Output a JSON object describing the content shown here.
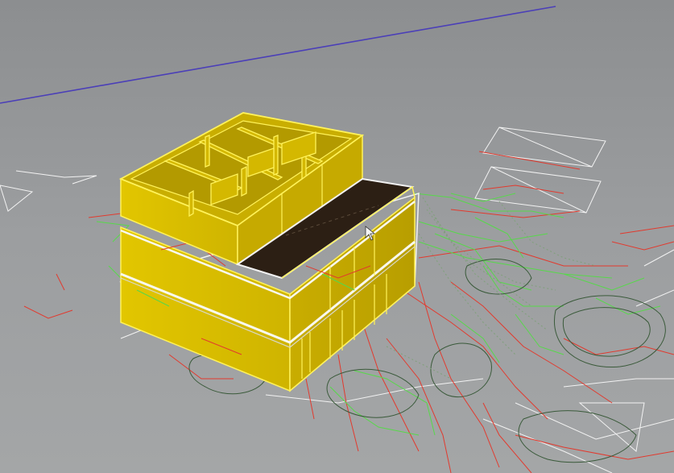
{
  "viewport": {
    "mode": "3d-perspective",
    "background_color": "#9a9c9d",
    "model": {
      "type": "building-massing",
      "floors": 3,
      "color_fill": "#e6c800",
      "color_edge": "#fff25a",
      "roof_color": "#2c1f14"
    },
    "site_plan_linework": {
      "colors": [
        "#e23a2e",
        "#57d84a",
        "#3a5a3a",
        "#ffffff",
        "#4b3fb8"
      ]
    }
  }
}
